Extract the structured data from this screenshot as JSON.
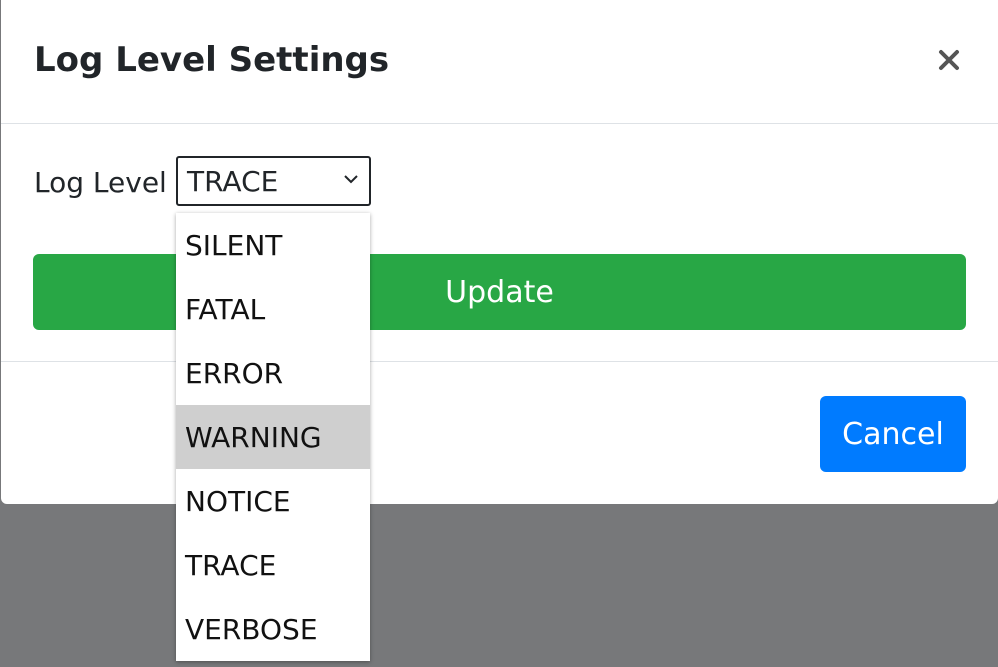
{
  "modal": {
    "title": "Log Level Settings",
    "close_icon": "close-icon",
    "close_glyph": "✕"
  },
  "form": {
    "log_level_label": "Log Level",
    "selected_value": "TRACE",
    "chevron_icon": "chevron-down-icon",
    "options": [
      "SILENT",
      "FATAL",
      "ERROR",
      "WARNING",
      "NOTICE",
      "TRACE",
      "VERBOSE"
    ],
    "hovered_option": "WARNING"
  },
  "buttons": {
    "update_label": "Update",
    "cancel_label": "Cancel"
  },
  "colors": {
    "backdrop": "#77787a",
    "update_green": "#28a745",
    "cancel_blue": "#007bff",
    "hover_gray": "#cfcfcf"
  }
}
